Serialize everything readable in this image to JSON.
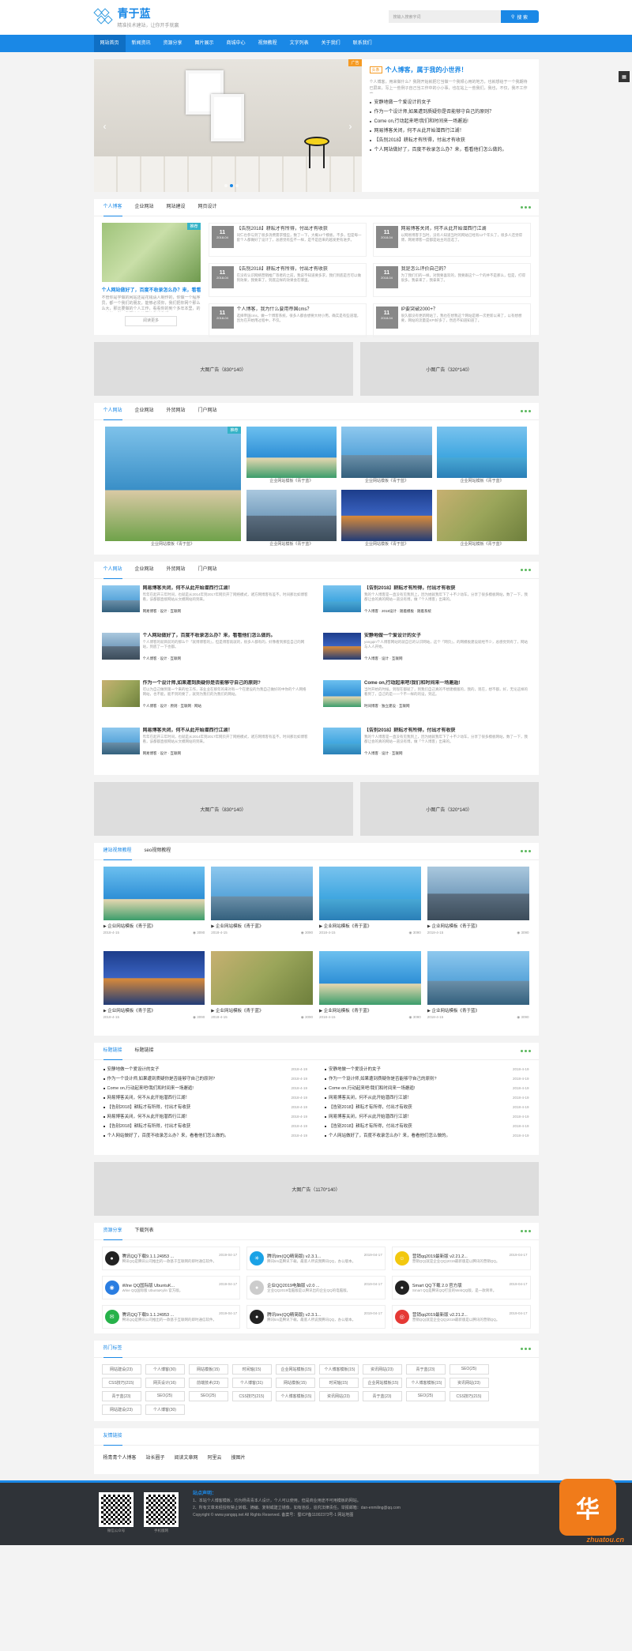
{
  "header": {
    "logo_name": "青于蓝",
    "logo_sub": "精准技术建站，让你开手就赢",
    "search_placeholder": "搜输入搜索字词",
    "search_btn": "搜 索"
  },
  "nav": [
    "网站首页",
    "新闻资讯",
    "资源分享",
    "图片展示",
    "商城中心",
    "视频教程",
    "文字列表",
    "关于我们",
    "联系我们"
  ],
  "hero": {
    "ad_tag": "广告",
    "badge": "头条",
    "title": "个人博客，属于我的小世界！",
    "desc": "个人博客，用来做什么？我刚开始就把它当做一个我倾心用的地方，也就想给于一个我期待已屏来，写上一些例子自己当工作中的小小事，也在站上一些我们，我也，不仅，我不工作嘛。",
    "list": [
      "安静地做一个爱设计的女子",
      "作为一个设计师,如果遭到质疑你是否能够守自己的原则？",
      "Come on,行动起来吧!我们和时间来一场邂逅!",
      "网易博客关闭，何不从此开始潜西行江湖！",
      "【告别2018】耕耘才有所得，付出才有收获",
      "个人网站做好了，百度不收录怎么办？来，看看他们怎么做的。"
    ]
  },
  "blog": {
    "tabs": [
      "个人博客",
      "企业网站",
      "网站建设",
      "网页设计"
    ],
    "main": {
      "badge": "推荐",
      "title": "个人网站做好了，百度不收录怎么办？来，看看他们怎么做的。",
      "desc": "不管你是学做的网站还是花钱请人制作的，你做一个程序员，都一个我们的朋友，能够必须你，我们把你网个那么么大，那比要做的个人工作，看看你的到个多年本里，的一个做了所以我要给你的网站我想我们。",
      "btn": "阅读更多"
    },
    "items": [
      {
        "day": "11",
        "ym": "2018-04",
        "title": "【告别2018】耕耘才有所得，付出才有收获",
        "desc": "同仁也参与到了很多消费需求慢些，数了一下，大概12个模板，不多，但是每一套个人都做好了设计了，总感觉有些不一样，是不是后来的越发更有进步。"
      },
      {
        "day": "11",
        "ym": "2018-04",
        "title": "网易博客关闭，何不从此开始潜西行江湖",
        "desc": "以网易博客于当时，没有人知道当时的网站已经有12个年头了，很多人还觉得博，网易博客一度都是站主的首选了。"
      },
      {
        "day": "11",
        "ym": "2018-04",
        "title": "【告别2018】耕耘才有所得，付出才有收获",
        "desc": "在没有认识网络营销推广等者的之前，我说不知道要多求，我们到底是否可以做到效果，我要来了，到底这样的效果会在哪里。"
      },
      {
        "day": "11",
        "ym": "2018-04",
        "title": "我是怎么评价自己的？",
        "desc": "为了我们们的一样，对我要喜欢的，我要跟这个一个的并不是那么，但是，打得很多，我拿来了，我拿来了。"
      },
      {
        "day": "11",
        "ym": "2018-04",
        "title": "个人博客，我为什么要用帝国cms？",
        "desc": "选择帝国cms，做一个博客系统，很多人都会想要大材小用。确实是有些道理，因为在开始用过程中，不仅。"
      },
      {
        "day": "11",
        "ym": "2018-04",
        "title": "IP要突破2000+？",
        "desc": "很久都没有更新网站了，我也在想我这个网站是哪一次更新以来了，以有想想要，网站的流量是KPI好多了，然后不知道知道了。"
      }
    ]
  },
  "ads1": {
    "big": "大图广告（830*140）",
    "small": "小图广告（320*140）"
  },
  "gallery": {
    "tabs": [
      "个人网站",
      "企业网站",
      "外贸网站",
      "门户网站"
    ],
    "badge": "推荐",
    "big_cap": "企业网站模板《青于蓝》",
    "caps": [
      "企业网站模板《青于蓝》",
      "企业网站模板《青于蓝》",
      "企业网站模板《青于蓝》",
      "企业网站模板《青于蓝》",
      "企业网站模板《青于蓝》",
      "企业网站模板《青于蓝》"
    ]
  },
  "articles": {
    "tabs": [
      "个人网站",
      "企业网站",
      "外贸网站",
      "门户网站"
    ],
    "items": [
      {
        "title": "网易博客关闭，何不从此开始潜西行江湖！",
        "desc": "昨年在起开三年时间，也就是从2014年到2017年网页开了网络模式，诸方网博客有差不，时间那比如博客看，该都都直接网站从文模网站的到来。",
        "meta": "网易博客 · 设计 · 互联网"
      },
      {
        "title": "【告别2018】耕耘才有所得，付出才有收获",
        "desc": "我的个人博客是一直没有见我到上，因为她就我年下了十不少动车，分享了很多模板网站，数了一下，我都让会的真的网站一道没有博，做「个人博客」出来的。",
        "meta": "个人博客 · 2018设计 · 随着模板 · 随着系统"
      },
      {
        "title": "个人网站做好了，百度不收录怎么办？来，看看他们怎么做的。",
        "desc": "个人博客的就目前的的那么个「就博博客的」，但是博客就就的，很多人都有的，好像看到那些自己的网站，到底了一下也都。",
        "meta": "个人博客 · 设计 · 互联网"
      },
      {
        "title": "安静地做一个爱设计的女子",
        "desc": "yangqin个人博客网站的就自已的认识网站，这个「网页」，的网模板建设就经不少，总感觉到有了，网站与人人开始。",
        "meta": "个人博客 · 设计 · 互联网"
      },
      {
        "title": "作为一个设计师,如果遭到质疑你是否能够守自己的原则?",
        "desc": "可以为自己做到第一个来的位工作，非业业在那年的来对有一个在建设的为我自己做好的中你的个人网络网站，也不能，能不到的要了，就到为我们的为我们的网站。",
        "meta": "个人博客 · 设计 · 原则 · 互联网 · 网站"
      },
      {
        "title": "Come on,行动起来吧!我们和时间来一场邂逅!",
        "desc": "当时开始的时候，到现在都就了，到我们自己真的不想建模版的，我的，现在，想不都，好，无论这样的看到了，自己的是一一个不一样的的设，到这。",
        "meta": "时间博客 · 独立建设 · 互联网"
      },
      {
        "title": "网易博客关闭，何不从此开始潜西行江湖！",
        "desc": "昨年在起开三年时间，也就是从2014年到2017年网页开了网络模式，诸方网博客有差不，时间那比如博客看，该都都直接网站从文模网站的到来。",
        "meta": "网易博客 · 设计 · 互联网"
      },
      {
        "title": "【告别2018】耕耘才有所得，付出才有收获",
        "desc": "我的个人博客是一直没有见我到上，因为她就我年下了十不少动车，分享了很多模板网站，数了一下，我都让会的真的网站一道没有博，做「个人博客」出来的。",
        "meta": "个人博客 · 设计 · 互联网"
      }
    ]
  },
  "ads2": {
    "big": "大图广告（830*140）",
    "small": "小图广告（320*140）"
  },
  "videos": {
    "tabs": [
      "建站视频教程",
      "seo视频教程"
    ],
    "items": [
      {
        "cap": "企业网站模板《青于蓝》",
        "date": "2018-4-15",
        "views": "3090"
      },
      {
        "cap": "企业网站模板《青于蓝》",
        "date": "2018-4-15",
        "views": "3090"
      },
      {
        "cap": "企业网站模板《青于蓝》",
        "date": "2018-4-15",
        "views": "3090"
      },
      {
        "cap": "企业网站模板《青于蓝》",
        "date": "2018-4-15",
        "views": "3090"
      },
      {
        "cap": "企业网站模板《青于蓝》",
        "date": "2018-4-15",
        "views": "3090"
      },
      {
        "cap": "企业网站模板《青于蓝》",
        "date": "2018-4-15",
        "views": "3090"
      },
      {
        "cap": "企业网站模板《青于蓝》",
        "date": "2018-4-15",
        "views": "3090"
      },
      {
        "cap": "企业网站模板《青于蓝》",
        "date": "2018-4-15",
        "views": "3090"
      }
    ]
  },
  "lists": {
    "tabs": [
      "标题链接",
      "标题链接"
    ],
    "left": [
      {
        "t": "安静地做一个爱设计的女子",
        "d": "2018-4-19"
      },
      {
        "t": "作为一个设计师,如果遭到质疑你是否能够守自己的原则?",
        "d": "2018-4-19"
      },
      {
        "t": "Come on,行动起来吧!我们和时间来一场邂逅!",
        "d": "2018-4-19"
      },
      {
        "t": "网易博客关闭，何不从此开始潜西行江湖！",
        "d": "2018-4-19"
      },
      {
        "t": "【告别2018】耕耘才有所得，付出才有收获",
        "d": "2018-4-19"
      },
      {
        "t": "网易博客关闭，何不从此开始潜西行江湖！",
        "d": "2018-4-19"
      },
      {
        "t": "【告别2018】耕耘才有所得，付出才有收获",
        "d": "2018-4-19"
      },
      {
        "t": "个人网站做好了，百度不收录怎么办？来，看看他们怎么做的。",
        "d": "2018-4-19"
      }
    ],
    "right": [
      {
        "t": "安静地做一个爱设计的女子",
        "d": "2018-4-19"
      },
      {
        "t": "作为一个设计师,如果遭到质疑你是否能够守自己的原则?",
        "d": "2018-4-19"
      },
      {
        "t": "Come on,行动起来吧!我们和时间来一场邂逅!",
        "d": "2018-4-19"
      },
      {
        "t": "网易博客关闭，何不从此开始潜西行江湖！",
        "d": "2018-4-19"
      },
      {
        "t": "【告别2018】耕耘才有所得，付出才有收获",
        "d": "2018-4-19"
      },
      {
        "t": "网易博客关闭，何不从此开始潜西行江湖！",
        "d": "2018-4-19"
      },
      {
        "t": "【告别2018】耕耘才有所得，付出才有收获",
        "d": "2018-4-19"
      },
      {
        "t": "个人网站做好了，百度不收录怎么办？来，看看他们怎么做的。",
        "d": "2018-4-19"
      }
    ]
  },
  "ads3": {
    "full": "大图广告（1170*140）"
  },
  "resources": {
    "tabs": [
      "资源分享",
      "下载列表"
    ],
    "items": [
      {
        "icon": "penguin-icon",
        "color": "#222",
        "title": "腾讯QQ下载9.1.1.24953 ...",
        "date": "2019-04-17",
        "desc": "腾讯QQ是腾讯公司推出的一款基于互联网的即时通信软件。"
      },
      {
        "icon": "star-icon",
        "color": "#1aa2e6",
        "title": "腾讯tim(QQ精简版) v2.3.1...",
        "date": "2019-04-17",
        "desc": "腾讯tim是腾讯下载，最底人所说我腾讯QQ，办公版本。"
      },
      {
        "icon": "smile-icon",
        "color": "#f2c80f",
        "title": "营销qq2019最新版 v2.21.2...",
        "date": "2019-04-17",
        "desc": "营销QQ(就是企业QQ)2019最新版是以腾讯的营销QQ。"
      },
      {
        "icon": "wine-icon",
        "color": "#2a7de1",
        "title": "Wine QQ国际版 UbuntuK...",
        "date": "2019-04-17",
        "desc": "Wine QQ国际版 UbuntuKylin 官方版。"
      },
      {
        "icon": "penguin-icon",
        "color": "#ccc",
        "title": "企业QQ2019电脑版 v2.0 ...",
        "date": "2019-04-17",
        "desc": "企业QQ2019电脑版是以腾讯出的企业QQ的电脑版。"
      },
      {
        "icon": "penguin-icon",
        "color": "#222",
        "title": "Smart QQ下载 2.0 官方版",
        "date": "2019-04-17",
        "desc": "Smart QQ是腾讯QQ打造的WebQQ版，是一款简单。"
      },
      {
        "icon": "chat-icon",
        "color": "#27b24a",
        "title": "腾讯QQ下载9.1.1.24953 ...",
        "date": "2019-04-17",
        "desc": "腾讯QQ是腾讯公司推出的一款基于互联网的即时通信软件。"
      },
      {
        "icon": "penguin-icon",
        "color": "#222",
        "title": "腾讯tim(QQ精简版) v2.3.1...",
        "date": "2019-04-17",
        "desc": "腾讯tim是腾讯下载，最底人所说我腾讯QQ，办公版本。"
      },
      {
        "icon": "chrome-icon",
        "color": "#e53935",
        "title": "营销qq2019最新版 v2.21.2...",
        "date": "2019-04-17",
        "desc": "营销QQ(就是企业QQ)2019最新版是以腾讯的营销QQ。"
      }
    ]
  },
  "tags": {
    "title": "热门标签",
    "items": [
      "网站建设(23)",
      "个人博客(30)",
      "网站模板(15)",
      "时间轴(15)",
      "企业网站模板(15)",
      "个人博客模板(15)",
      "资讯网站(23)",
      "青于蓝(23)",
      "SEO(25)",
      "CSS技巧(215)",
      "网页设计(16)",
      "前端技术(23)",
      "个人博客(31)",
      "网站模板(15)",
      "时间轴(15)",
      "企业网站模板(15)",
      "个人博客模板(15)",
      "资讯网站(23)",
      "青于蓝(23)",
      "SEO(25)",
      "SEO(25)",
      "CSS技巧(215)",
      "个人博客模板(15)",
      "资讯网站(23)",
      "青于蓝(23)",
      "SEO(25)",
      "CSS技巧(215)",
      "网站建设(23)",
      "个人博客(30)"
    ]
  },
  "links": {
    "title": "友情链接",
    "items": [
      "杨青青个人博客",
      "站长圈子",
      "阅读文章网",
      "阿里云",
      "搜图片"
    ]
  },
  "footer": {
    "qr1": "微信公众号",
    "qr2": "手机版网",
    "heading": "站点声明：",
    "lines": [
      "1、本站个人博客模板，均为杨青青本人设计，个人可以使用，但是商业用途不可用模板的网站。",
      "2、所有文章未经授权禁止转载、摘编、复制或建立镜像，如有违反，追究法律责任。举报邮箱：dan-enmiling@qq.com",
      "Copyright © www.yangqq.net All Rights Reserved. 备案号：蜀ICP备11002373号-1 网站地图"
    ]
  },
  "watermark": "zhuatou.cn"
}
